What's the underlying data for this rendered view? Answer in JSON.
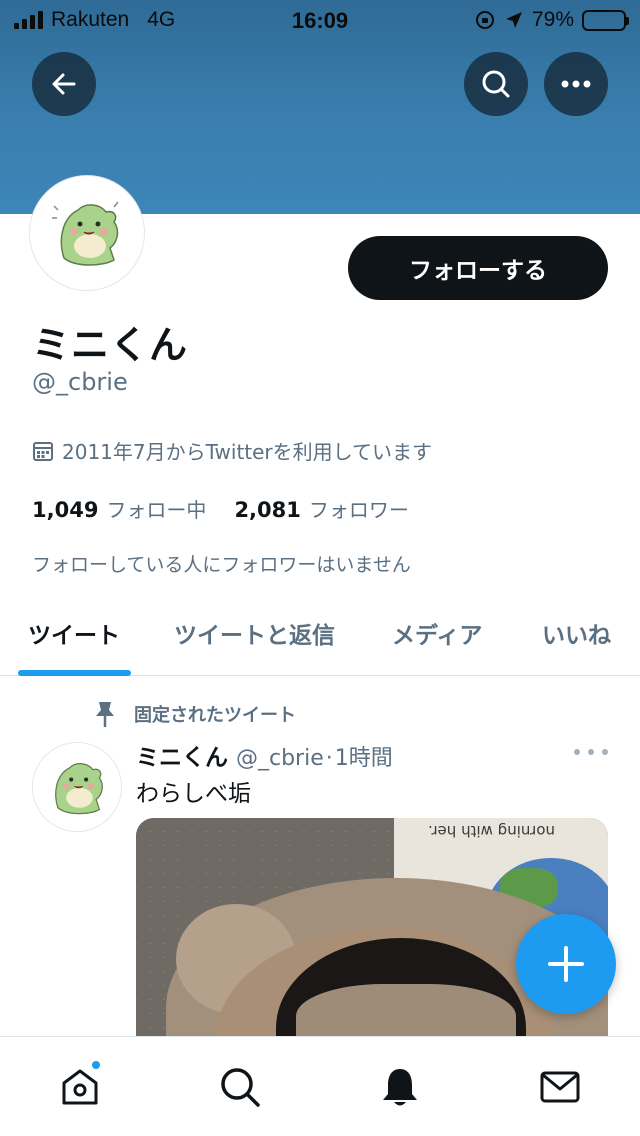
{
  "status_bar": {
    "carrier": "Rakuten",
    "network": "4G",
    "time": "16:09",
    "battery": "79%",
    "battery_level": 0.79
  },
  "header": {
    "back_icon": "arrow-left-icon",
    "search_icon": "search-icon",
    "more_icon": "ellipsis-icon",
    "banner_color": "#3a7eae"
  },
  "profile": {
    "display_name": "ミニくん",
    "handle": "@_cbrie",
    "follow_label": "フォローする",
    "joined": "2011年7月からTwitterを利用しています",
    "following_count": "1,049",
    "following_label": "フォロー中",
    "followers_count": "2,081",
    "followers_label": "フォロワー",
    "mutual_note": "フォローしている人にフォロワーはいません"
  },
  "tabs": [
    {
      "label": "ツイート",
      "active": true
    },
    {
      "label": "ツイートと返信",
      "active": false
    },
    {
      "label": "メディア",
      "active": false
    },
    {
      "label": "いいね",
      "active": false
    }
  ],
  "pinned_tweet": {
    "pinned_label": "固定されたツイート",
    "name": "ミニくん",
    "handle": "@_cbrie",
    "separator": "·",
    "time": "1時間",
    "text": "わらしべ垢",
    "media_text": "norning with her."
  },
  "bottom_nav": {
    "items": [
      "home-icon",
      "search-icon",
      "bell-icon",
      "mail-icon"
    ],
    "accent": "#1d9bf0"
  }
}
